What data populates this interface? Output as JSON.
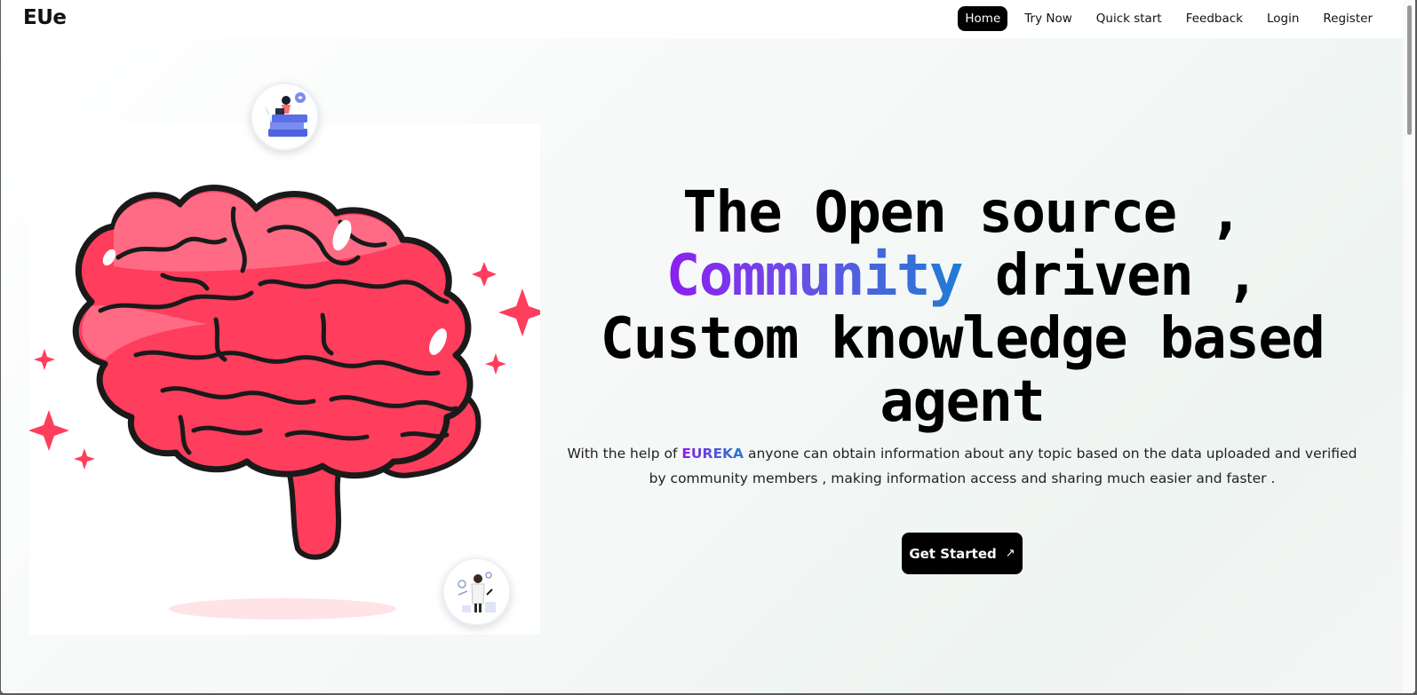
{
  "brand": {
    "logo": "EUe"
  },
  "nav": {
    "items": [
      {
        "label": "Home",
        "active": true
      },
      {
        "label": "Try Now",
        "active": false
      },
      {
        "label": "Quick start",
        "active": false
      },
      {
        "label": "Feedback",
        "active": false
      },
      {
        "label": "Login",
        "active": false
      },
      {
        "label": "Register",
        "active": false
      }
    ]
  },
  "hero": {
    "line1": "The Open source ,",
    "line2_highlight": "Community",
    "line2_rest": " driven ,",
    "line3": "Custom knowledge based",
    "line4": "agent",
    "desc_prefix": "With the help of ",
    "desc_brand": "EUREKA",
    "desc_suffix": " anyone can obtain information about any topic based on the data uploaded and verified by community members , making information access and sharing much easier and faster .",
    "cta_label": "Get Started",
    "cta_icon": "arrow-up-right-icon"
  },
  "illustration": {
    "main": "brain-illustration",
    "top_avatar": "person-on-books-icon",
    "bottom_avatar": "scientist-icon"
  },
  "colors": {
    "gradient_start": "#8c1ef0",
    "gradient_end": "#1f7ed2",
    "brain_fill": "#ff3d5c",
    "brain_light": "#ff6b85",
    "primary_button": "#000000"
  }
}
